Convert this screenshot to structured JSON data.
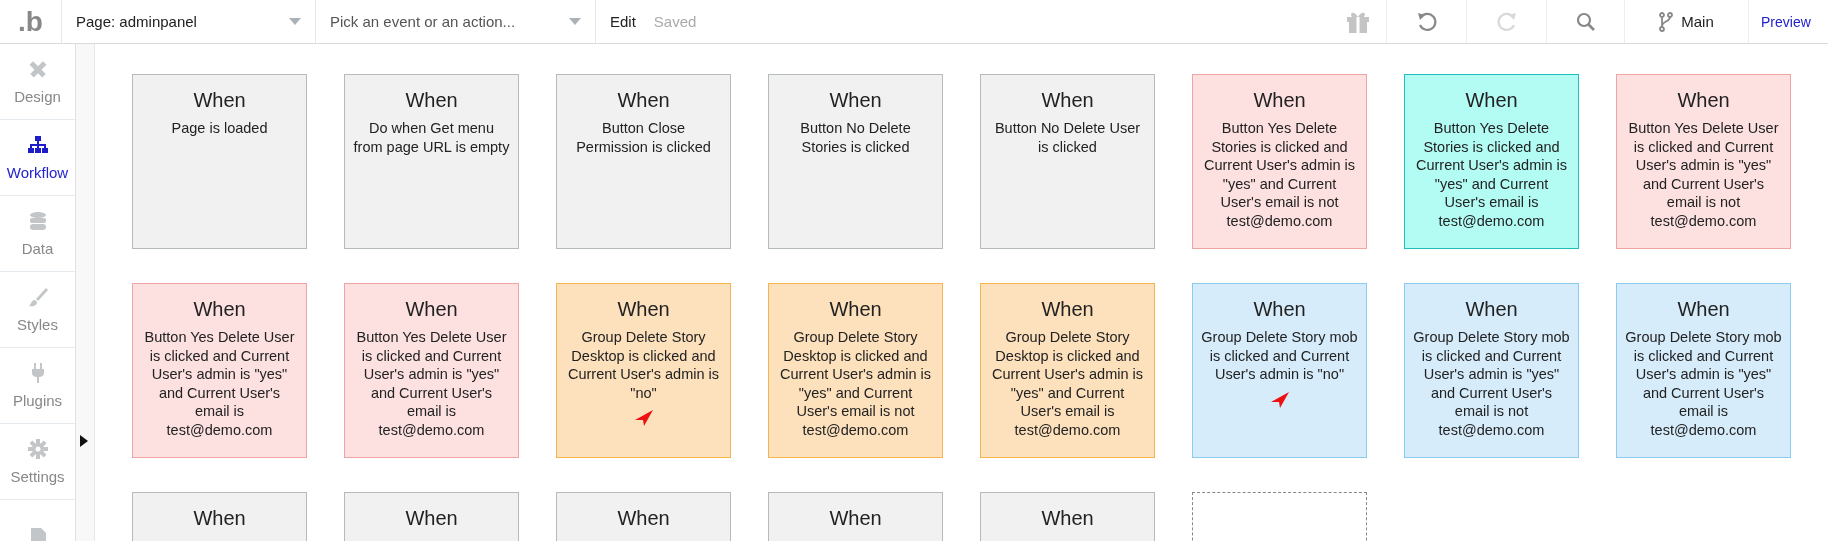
{
  "topbar": {
    "logo": ".b",
    "page_dropdown": "Page: adminpanel",
    "event_dropdown": {
      "placeholder": "Pick an event or an action..."
    },
    "edit": "Edit",
    "saved": "Saved",
    "branch": "Main",
    "preview": "Preview"
  },
  "sidebar": {
    "items": [
      {
        "label": "Design",
        "kind": "design",
        "selected": false
      },
      {
        "label": "Workflow",
        "kind": "workflow",
        "selected": true
      },
      {
        "label": "Data",
        "kind": "data",
        "selected": false
      },
      {
        "label": "Styles",
        "kind": "styles",
        "selected": false
      },
      {
        "label": "Plugins",
        "kind": "plugins",
        "selected": false
      },
      {
        "label": "Settings",
        "kind": "settings",
        "selected": false
      },
      {
        "kind": "document",
        "selected": false
      }
    ]
  },
  "events": [
    {
      "title": "When",
      "condition": "Page is loaded",
      "color": "#f0f1f0",
      "warning": false
    },
    {
      "title": "When",
      "condition": "Do when Get menu from page URL is empty",
      "color": "#f0f1f0",
      "warning": false
    },
    {
      "title": "When",
      "condition": "Button Close Permission is clicked",
      "color": "#f0f1f0",
      "warning": false
    },
    {
      "title": "When",
      "condition": "Button No Delete Stories is clicked",
      "color": "#f0f1f0",
      "warning": false
    },
    {
      "title": "When",
      "condition": "Button No Delete User is clicked",
      "color": "#f0f1f0",
      "warning": false
    },
    {
      "title": "When",
      "condition": "Button Yes Delete Stories is clicked and Current User's admin is \"yes\" and Current User's email is not test@demo.com",
      "color": "#fde0e0",
      "warning": false
    },
    {
      "title": "When",
      "condition": "Button Yes Delete Stories is clicked and Current User's admin is \"yes\" and Current User's email is test@demo.com",
      "color": "#b3fcf4",
      "warning": false
    },
    {
      "title": "When",
      "condition": "Button Yes Delete User is clicked and Current User's admin is \"yes\" and Current User's email is not test@demo.com",
      "color": "#fde0e0",
      "warning": false
    },
    {
      "title": "When",
      "condition": "Button Yes Delete User is clicked and Current User's admin is \"yes\" and Current User's email is test@demo.com",
      "color": "#fde0e0",
      "warning": false
    },
    {
      "title": "When",
      "condition": "Button Yes Delete User is clicked and Current User's admin is \"yes\" and Current User's email is test@demo.com",
      "color": "#fde0e0",
      "warning": false
    },
    {
      "title": "When",
      "condition": "Group Delete Story Desktop is clicked and Current User's admin is \"no\"",
      "color": "#fde0bc",
      "warning": true
    },
    {
      "title": "When",
      "condition": "Group Delete Story Desktop is clicked and Current User's admin is \"yes\" and Current User's email is not test@demo.com",
      "color": "#fde0bc",
      "warning": false
    },
    {
      "title": "When",
      "condition": "Group Delete Story Desktop is clicked and Current User's admin is \"yes\" and Current User's email is test@demo.com",
      "color": "#fde0bc",
      "warning": false
    },
    {
      "title": "When",
      "condition": "Group Delete Story mob is clicked and Current User's admin is \"no\"",
      "color": "#d6ecfb",
      "warning": true
    },
    {
      "title": "When",
      "condition": "Group Delete Story mob is clicked and Current User's admin is \"yes\" and Current User's email is not test@demo.com",
      "color": "#d6ecfb",
      "warning": false
    },
    {
      "title": "When",
      "condition": "Group Delete Story mob is clicked and Current User's admin is \"yes\" and Current User's email is test@demo.com",
      "color": "#d6ecfb",
      "warning": false
    },
    {
      "title": "When",
      "color": "#f0f1f0",
      "warning": false
    },
    {
      "title": "When",
      "color": "#f0f1f0",
      "warning": false
    },
    {
      "title": "When",
      "color": "#f0f1f0",
      "warning": false
    },
    {
      "title": "When",
      "color": "#f0f1f0",
      "warning": false
    },
    {
      "title": "When",
      "color": "#f0f1f0",
      "warning": false
    }
  ]
}
